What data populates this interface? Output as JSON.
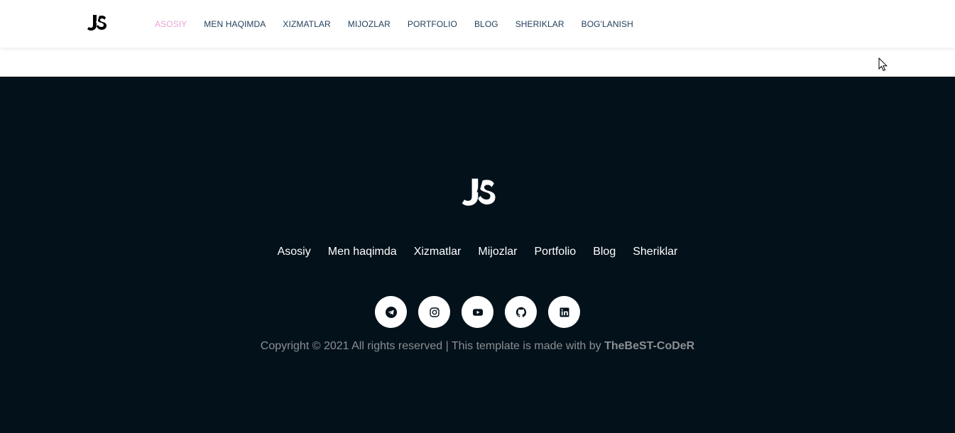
{
  "navbar": {
    "logo_icon": "js-logo-icon",
    "items": [
      {
        "label": "ASOSIY",
        "active": true
      },
      {
        "label": "MEN HAQIMDA",
        "active": false
      },
      {
        "label": "XIZMATLAR",
        "active": false
      },
      {
        "label": "MIJOZLAR",
        "active": false
      },
      {
        "label": "PORTFOLIO",
        "active": false
      },
      {
        "label": "BLOG",
        "active": false
      },
      {
        "label": "SHERIKLAR",
        "active": false
      },
      {
        "label": "BOG'LANISH",
        "active": false
      }
    ],
    "active_color": "#e8a5d6",
    "link_color": "#1f3d5a"
  },
  "footer": {
    "background": "#03111a",
    "logo_icon": "js-logo-icon",
    "links": [
      "Asosiy",
      "Men haqimda",
      "Xizmatlar",
      "Mijozlar",
      "Portfolio",
      "Blog",
      "Sheriklar"
    ],
    "social": [
      {
        "icon": "telegram-icon"
      },
      {
        "icon": "instagram-icon"
      },
      {
        "icon": "youtube-icon"
      },
      {
        "icon": "github-icon"
      },
      {
        "icon": "linkedin-icon"
      }
    ],
    "copyright_text": "Copyright © 2021 All rights reserved | This template is made with by ",
    "copyright_author": "TheBeST-CoDeR"
  }
}
